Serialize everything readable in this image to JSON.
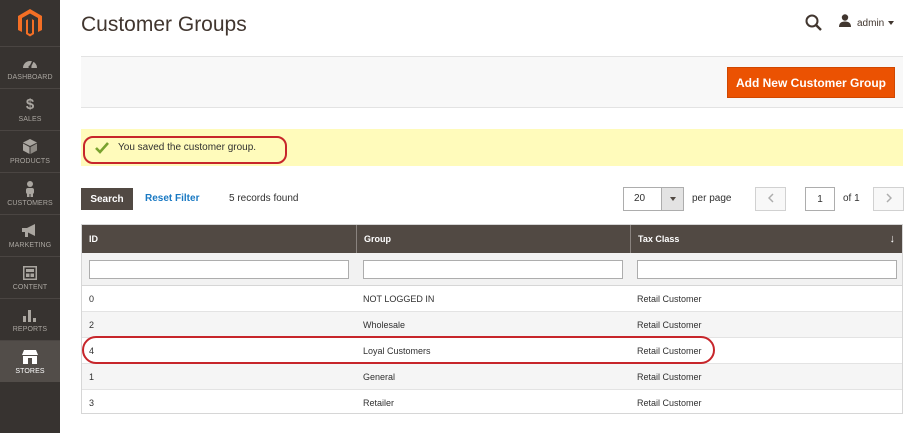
{
  "sidebar": {
    "items": [
      {
        "label": "DASHBOARD",
        "icon": "dashboard-icon"
      },
      {
        "label": "SALES",
        "icon": "dollar-icon"
      },
      {
        "label": "PRODUCTS",
        "icon": "box-icon"
      },
      {
        "label": "CUSTOMERS",
        "icon": "person-icon"
      },
      {
        "label": "MARKETING",
        "icon": "megaphone-icon"
      },
      {
        "label": "CONTENT",
        "icon": "layout-icon"
      },
      {
        "label": "REPORTS",
        "icon": "bar-chart-icon"
      },
      {
        "label": "STORES",
        "icon": "store-icon",
        "active": true
      }
    ]
  },
  "header": {
    "title": "Customer Groups",
    "user": "admin"
  },
  "actions": {
    "add_label": "Add New Customer Group"
  },
  "message": {
    "text": "You saved the customer group."
  },
  "toolbar": {
    "search_label": "Search",
    "reset_label": "Reset Filter",
    "records": "5 records found",
    "per_page_value": "20",
    "per_page_label": "per page",
    "page_value": "1",
    "of_label": "of 1"
  },
  "grid": {
    "columns": [
      "ID",
      "Group",
      "Tax Class"
    ],
    "sort_indicator": "↓",
    "rows": [
      [
        "0",
        "NOT LOGGED IN",
        "Retail Customer"
      ],
      [
        "2",
        "Wholesale",
        "Retail Customer"
      ],
      [
        "4",
        "Loyal Customers",
        "Retail Customer"
      ],
      [
        "1",
        "General",
        "Retail Customer"
      ],
      [
        "3",
        "Retailer",
        "Retail Customer"
      ]
    ]
  },
  "colors": {
    "sidebar_bg": "#373330",
    "accent": "#eb5202",
    "grid_header": "#514943",
    "message_bg": "#fffbbb",
    "highlight": "#c7262b"
  }
}
